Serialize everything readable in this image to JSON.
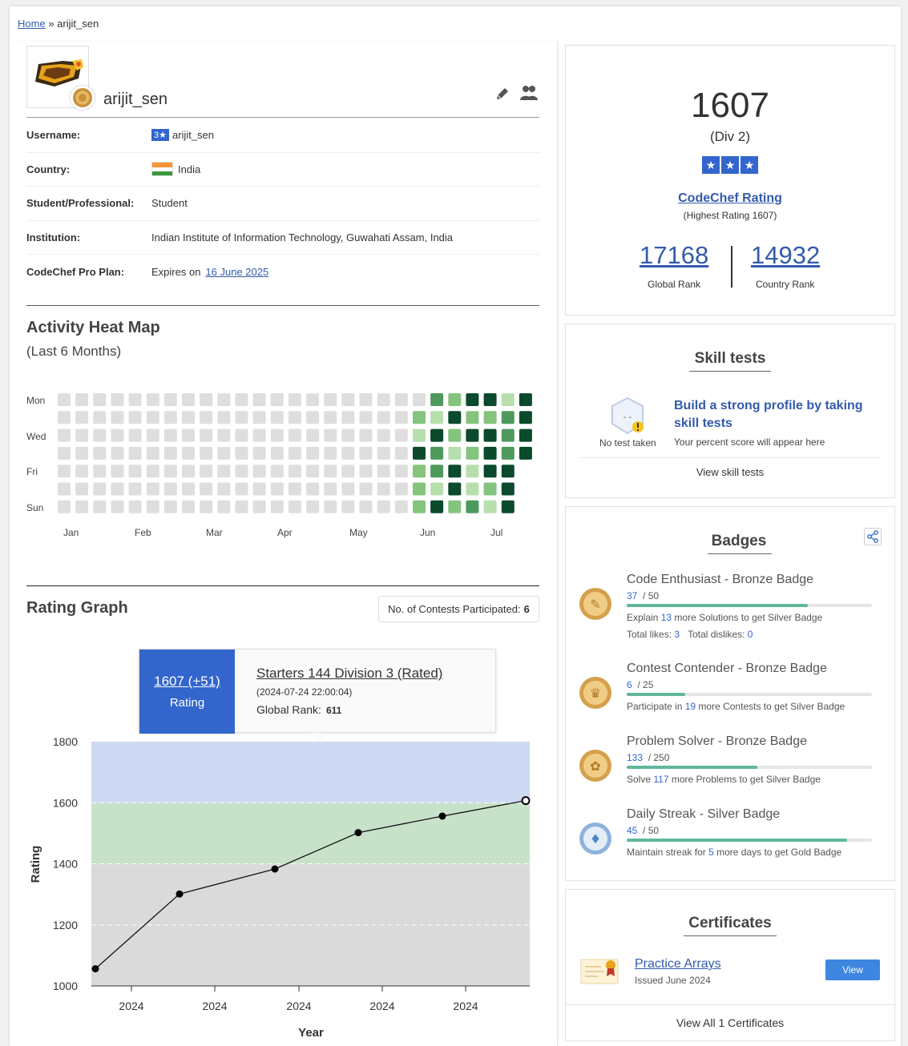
{
  "breadcrumb": {
    "home": "Home",
    "separator": "»",
    "current": "arijit_sen"
  },
  "profile": {
    "display_name": "arijit_sen",
    "details": [
      {
        "label": "Username:",
        "value": "arijit_sen",
        "stars": "3★"
      },
      {
        "label": "Country:",
        "value": "India"
      },
      {
        "label": "Student/Professional:",
        "value": "Student"
      },
      {
        "label": "Institution:",
        "value": "Indian Institute of Information Technology, Guwahati Assam, India"
      },
      {
        "label": "CodeChef Pro Plan:",
        "value_prefix": "Expires on",
        "value_link": "16 June 2025"
      }
    ]
  },
  "heatmap": {
    "title": "Activity Heat Map",
    "subtitle": "(Last 6 Months)",
    "day_labels": [
      "Mon",
      "Wed",
      "Fri",
      "Sun"
    ],
    "month_labels": [
      "Jan",
      "Feb",
      "Mar",
      "Apr",
      "May",
      "Jun",
      "Jul"
    ],
    "levels": [
      [
        0,
        0,
        0,
        0,
        0,
        0,
        0,
        0,
        0,
        0,
        0,
        0,
        0,
        0,
        0,
        0,
        0,
        0,
        0,
        0,
        0,
        3,
        2,
        4,
        4,
        1,
        4
      ],
      [
        0,
        0,
        0,
        0,
        0,
        0,
        0,
        0,
        0,
        0,
        0,
        0,
        0,
        0,
        0,
        0,
        0,
        0,
        0,
        0,
        2,
        1,
        4,
        2,
        2,
        3,
        4
      ],
      [
        0,
        0,
        0,
        0,
        0,
        0,
        0,
        0,
        0,
        0,
        0,
        0,
        0,
        0,
        0,
        0,
        0,
        0,
        0,
        0,
        1,
        4,
        2,
        4,
        4,
        3,
        4
      ],
      [
        0,
        0,
        0,
        0,
        0,
        0,
        0,
        0,
        0,
        0,
        0,
        0,
        0,
        0,
        0,
        0,
        0,
        0,
        0,
        0,
        4,
        3,
        1,
        2,
        4,
        3,
        4
      ],
      [
        0,
        0,
        0,
        0,
        0,
        0,
        0,
        0,
        0,
        0,
        0,
        0,
        0,
        0,
        0,
        0,
        0,
        0,
        0,
        0,
        2,
        3,
        4,
        1,
        4,
        4,
        -1
      ],
      [
        0,
        0,
        0,
        0,
        0,
        0,
        0,
        0,
        0,
        0,
        0,
        0,
        0,
        0,
        0,
        0,
        0,
        0,
        0,
        0,
        2,
        1,
        4,
        1,
        2,
        4,
        -1
      ],
      [
        0,
        0,
        0,
        0,
        0,
        0,
        0,
        0,
        0,
        0,
        0,
        0,
        0,
        0,
        0,
        0,
        0,
        0,
        0,
        0,
        2,
        4,
        2,
        3,
        1,
        4,
        -1
      ]
    ],
    "colors": [
      "#dedede",
      "#b7dfae",
      "#85c47e",
      "#4e9a5c",
      "#0b4a2c"
    ]
  },
  "rating_graph": {
    "title": "Rating Graph",
    "contests_label": "No. of Contests Participated:",
    "contests_count": "6",
    "tooltip": {
      "rating": "1607 (+51)",
      "rating_label": "Rating",
      "contest": "Starters 144 Division 3 (Rated)",
      "date": "(2024-07-24 22:00:04)",
      "rank_label": "Global Rank:",
      "rank_value": "611"
    }
  },
  "chart_data": {
    "type": "line",
    "title": "",
    "xlabel": "Year",
    "ylabel": "Rating",
    "x_tick_labels": [
      "2024",
      "2024",
      "2024",
      "2024",
      "2024"
    ],
    "y_ticks": [
      1000,
      1200,
      1400,
      1600,
      1800
    ],
    "ylim": [
      1000,
      1800
    ],
    "bands": [
      {
        "from": 1000,
        "to": 1400,
        "color": "#dadada"
      },
      {
        "from": 1400,
        "to": 1600,
        "color": "#c8e2ca"
      },
      {
        "from": 1600,
        "to": 1800,
        "color": "#cdd9f2"
      }
    ],
    "series": [
      {
        "values": [
          1056,
          1301,
          1383,
          1502,
          1556,
          1607
        ]
      }
    ]
  },
  "rating_card": {
    "rating": "1607",
    "division": "(Div 2)",
    "stars": [
      "★",
      "★",
      "★"
    ],
    "link": "CodeChef Rating",
    "highest": "(Highest Rating 1607)",
    "global_rank": "17168",
    "global_rank_label": "Global Rank",
    "country_rank": "14932",
    "country_rank_label": "Country Rank"
  },
  "skill_tests": {
    "title": "Skill tests",
    "icon_text": "- -",
    "no_test": "No test taken",
    "headline": "Build a strong profile by taking skill tests",
    "sub": "Your percent score will appear here",
    "view": "View skill tests"
  },
  "badges": {
    "title": "Badges",
    "items": [
      {
        "name": "Code Enthusiast - Bronze Badge",
        "count": "37",
        "total": "/ 50",
        "progress": 0.74,
        "text_pre": "Explain",
        "text_num": "13",
        "text_post": "more Solutions to get Silver Badge",
        "likes_label": "Total likes:",
        "likes": "3",
        "dislikes_label": "Total dislikes:",
        "dislikes": "0",
        "medal": "bronze",
        "glyph": "✎"
      },
      {
        "name": "Contest Contender - Bronze Badge",
        "count": "6",
        "total": "/ 25",
        "progress": 0.24,
        "text_pre": "Participate in",
        "text_num": "19",
        "text_post": "more Contests to get Silver Badge",
        "medal": "bronze",
        "glyph": "♛"
      },
      {
        "name": "Problem Solver - Bronze Badge",
        "count": "133",
        "total": "/ 250",
        "progress": 0.532,
        "text_pre": "Solve",
        "text_num": "117",
        "text_post": "more Problems to get Silver Badge",
        "medal": "bronze",
        "glyph": "✿"
      },
      {
        "name": "Daily Streak - Silver Badge",
        "count": "45",
        "total": "/ 50",
        "progress": 0.9,
        "text_pre": "Maintain streak for",
        "text_num": "5",
        "text_post": "more days to get Gold Badge",
        "medal": "silver",
        "glyph": "♦"
      }
    ]
  },
  "certificates": {
    "title": "Certificates",
    "name": "Practice Arrays",
    "issued": "Issued June 2024",
    "view": "View",
    "view_all": "View All 1 Certificates"
  }
}
